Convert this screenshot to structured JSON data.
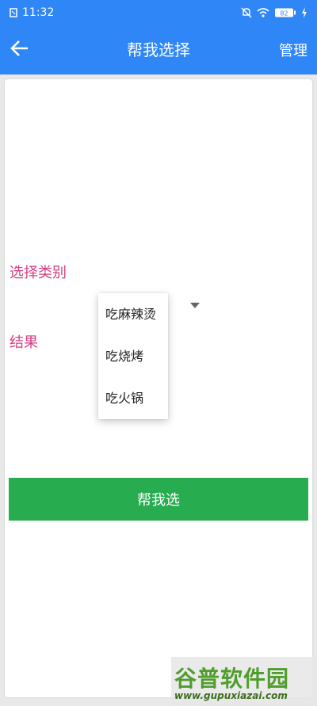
{
  "status_bar": {
    "time": "11:32",
    "battery": "82"
  },
  "app_bar": {
    "title": "帮我选择",
    "manage_label": "管理"
  },
  "form": {
    "category_label": "选择类别",
    "result_label": "结果"
  },
  "dropdown": {
    "options": [
      "吃麻辣烫",
      "吃烧烤",
      "吃火锅"
    ]
  },
  "action_button": {
    "label": "帮我选"
  },
  "watermark": {
    "logo": "谷普软件园",
    "url": "www.gupuxiazai.com"
  },
  "colors": {
    "app_bar": "#2f86f6",
    "label": "#d33f83",
    "button": "#27ad4f"
  },
  "icons": [
    "back-arrow-icon",
    "mute-icon",
    "wifi-icon",
    "battery-icon",
    "charging-icon",
    "dropdown-arrow-icon"
  ]
}
